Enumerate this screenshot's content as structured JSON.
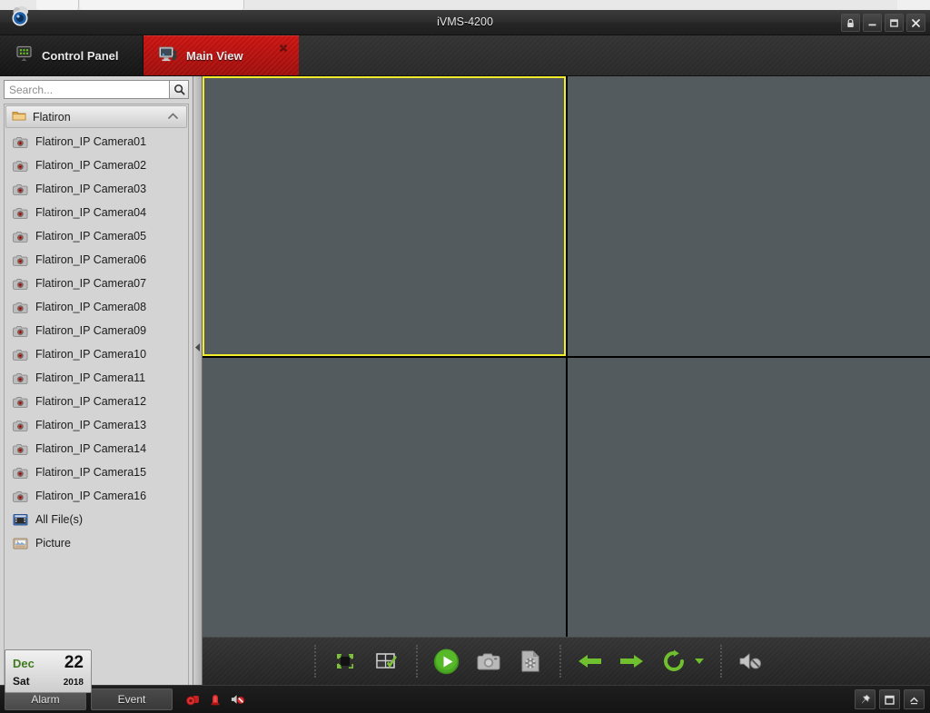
{
  "window": {
    "title": "iVMS-4200",
    "controls": [
      {
        "name": "lock-button",
        "icon": "lock-icon"
      },
      {
        "name": "minimize-button",
        "icon": "minimize-icon"
      },
      {
        "name": "maximize-button",
        "icon": "maximize-icon"
      },
      {
        "name": "close-button",
        "icon": "close-icon"
      }
    ]
  },
  "tabs": [
    {
      "label": "Control Panel",
      "icon": "control-panel-icon",
      "active": false,
      "closable": false
    },
    {
      "label": "Main View",
      "icon": "monitor-icon",
      "active": true,
      "closable": true,
      "close_label": "×"
    }
  ],
  "sidebar": {
    "search": {
      "value": "",
      "placeholder": "Search...",
      "button_icon": "search-icon"
    },
    "group": {
      "label": "Flatiron",
      "icon": "folder-icon",
      "expanded": true,
      "chevron_icon": "chevron-up-icon"
    },
    "items": [
      {
        "label": "Flatiron_IP Camera01",
        "icon": "camera-icon"
      },
      {
        "label": "Flatiron_IP Camera02",
        "icon": "camera-icon"
      },
      {
        "label": "Flatiron_IP Camera03",
        "icon": "camera-icon"
      },
      {
        "label": "Flatiron_IP Camera04",
        "icon": "camera-icon"
      },
      {
        "label": "Flatiron_IP Camera05",
        "icon": "camera-icon"
      },
      {
        "label": "Flatiron_IP Camera06",
        "icon": "camera-icon"
      },
      {
        "label": "Flatiron_IP Camera07",
        "icon": "camera-icon"
      },
      {
        "label": "Flatiron_IP Camera08",
        "icon": "camera-icon"
      },
      {
        "label": "Flatiron_IP Camera09",
        "icon": "camera-icon"
      },
      {
        "label": "Flatiron_IP Camera10",
        "icon": "camera-icon"
      },
      {
        "label": "Flatiron_IP Camera11",
        "icon": "camera-icon"
      },
      {
        "label": "Flatiron_IP Camera12",
        "icon": "camera-icon"
      },
      {
        "label": "Flatiron_IP Camera13",
        "icon": "camera-icon"
      },
      {
        "label": "Flatiron_IP Camera14",
        "icon": "camera-icon"
      },
      {
        "label": "Flatiron_IP Camera15",
        "icon": "camera-icon"
      },
      {
        "label": "Flatiron_IP Camera16",
        "icon": "camera-icon"
      },
      {
        "label": "All File(s)",
        "icon": "video-file-icon"
      },
      {
        "label": "Picture",
        "icon": "picture-icon"
      }
    ]
  },
  "splitter": {
    "collapse_icon": "collapse-left-icon"
  },
  "video": {
    "layout": "2x2",
    "pane_color": "#545b5e",
    "selected_border_color": "#f2ec2a",
    "panes": [
      {
        "index": 1,
        "selected": true,
        "content": ""
      },
      {
        "index": 2,
        "selected": false,
        "content": ""
      },
      {
        "index": 3,
        "selected": false,
        "content": ""
      },
      {
        "index": 4,
        "selected": false,
        "content": ""
      }
    ]
  },
  "toolbar": {
    "groups": [
      {
        "buttons": [
          {
            "name": "full-screen-button",
            "icon": "full-screen-icon"
          },
          {
            "name": "layout-select-button",
            "icon": "layout-check-icon"
          }
        ]
      },
      {
        "buttons": [
          {
            "name": "play-all-button",
            "icon": "play-icon"
          },
          {
            "name": "capture-button",
            "icon": "camera-capture-icon"
          },
          {
            "name": "record-button",
            "icon": "video-record-icon"
          }
        ]
      },
      {
        "buttons": [
          {
            "name": "previous-page-button",
            "icon": "arrow-left-icon"
          },
          {
            "name": "next-page-button",
            "icon": "arrow-right-icon"
          },
          {
            "name": "auto-switch-button",
            "icon": "refresh-loop-icon"
          },
          {
            "name": "auto-switch-dropdown",
            "icon": "caret-down-icon"
          }
        ]
      },
      {
        "buttons": [
          {
            "name": "mute-button",
            "icon": "speaker-mute-icon"
          }
        ]
      }
    ]
  },
  "status_bar": {
    "date": {
      "month": "Dec",
      "day": "22",
      "weekday": "Sat",
      "year": "2018"
    },
    "buttons": [
      {
        "label": "Alarm",
        "name": "alarm-tab-button",
        "active": true
      },
      {
        "label": "Event",
        "name": "event-tab-button",
        "active": false
      }
    ],
    "indicators": [
      {
        "name": "alarm-output-icon"
      },
      {
        "name": "alarm-siren-icon"
      },
      {
        "name": "audio-off-icon"
      }
    ],
    "right_buttons": [
      {
        "name": "pin-button",
        "icon": "pin-icon"
      },
      {
        "name": "restore-panel-button",
        "icon": "window-icon"
      },
      {
        "name": "collapse-panel-button",
        "icon": "chevron-up-icon"
      }
    ]
  },
  "colors": {
    "accent_red": "#c9120f",
    "accent_green": "#5cb82b",
    "selection_yellow": "#f2ec2a",
    "video_bg": "#545b5e",
    "sidebar_bg": "#d4d4d4"
  }
}
